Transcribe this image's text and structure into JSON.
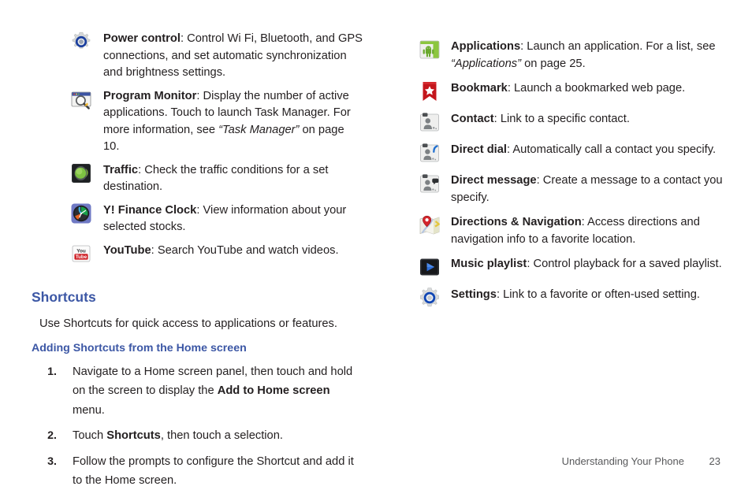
{
  "page": {
    "footer_section": "Understanding Your Phone",
    "footer_page_number": "23",
    "heading_color": "#3c57a5",
    "body_color": "#231f20"
  },
  "left_column": {
    "widgets": [
      {
        "icon": "power-control-gear-icon",
        "term": "Power control",
        "description": ": Control Wi Fi, Bluetooth, and GPS connections, and set automatic synchronization and brightness settings."
      },
      {
        "icon": "program-monitor-window-magnifier-icon",
        "term": "Program Monitor",
        "description": ": Display the number of active applications. Touch to launch Task Manager. For more information, see ",
        "cross_reference": "“Task Manager”",
        "description_tail": " on page 10."
      },
      {
        "icon": "traffic-light-icon",
        "term": "Traffic",
        "description": ": Check the traffic conditions for a set destination."
      },
      {
        "icon": "y-finance-clock-icon",
        "term": "Y! Finance Clock",
        "description": ": View information about your selected stocks."
      },
      {
        "icon": "youtube-icon",
        "term": "YouTube",
        "description": ": Search YouTube and watch videos."
      }
    ],
    "shortcuts_heading": "Shortcuts",
    "shortcuts_intro": "Use Shortcuts for quick access to applications or features.",
    "adding_heading": "Adding Shortcuts from the Home screen",
    "steps": [
      {
        "number": "1.",
        "text_before": "Navigate to a Home screen panel, then touch and hold on the screen to display the ",
        "bold": "Add to Home screen",
        "text_after": " menu."
      },
      {
        "number": "2.",
        "text_before": "Touch ",
        "bold": "Shortcuts",
        "text_after": ", then touch a selection."
      },
      {
        "number": "3.",
        "text_before": "Follow the prompts to configure the Shortcut and add it to the Home screen.",
        "bold": "",
        "text_after": ""
      }
    ]
  },
  "right_column": {
    "shortcuts": [
      {
        "icon": "applications-android-icon",
        "term": "Applications",
        "description": ": Launch an application. For a list, see ",
        "cross_reference": "“Applications”",
        "description_tail": " on page 25."
      },
      {
        "icon": "bookmark-ribbon-star-icon",
        "term": "Bookmark",
        "description": ": Launch a bookmarked web page."
      },
      {
        "icon": "contact-icon",
        "term": "Contact",
        "description": ": Link to a specific contact."
      },
      {
        "icon": "direct-dial-icon",
        "term": "Direct dial",
        "description": ": Automatically call a contact you specify."
      },
      {
        "icon": "direct-message-icon",
        "term": "Direct message",
        "description": ": Create a message to a contact you specify."
      },
      {
        "icon": "directions-navigation-map-icon",
        "term": "Directions & Navigation",
        "description": ": Access directions and navigation info to a favorite location."
      },
      {
        "icon": "music-playlist-play-icon",
        "term": "Music playlist",
        "description": ": Control playback for a saved playlist."
      },
      {
        "icon": "settings-gear-icon",
        "term": "Settings",
        "description": ": Link to a favorite or often-used setting."
      }
    ]
  }
}
